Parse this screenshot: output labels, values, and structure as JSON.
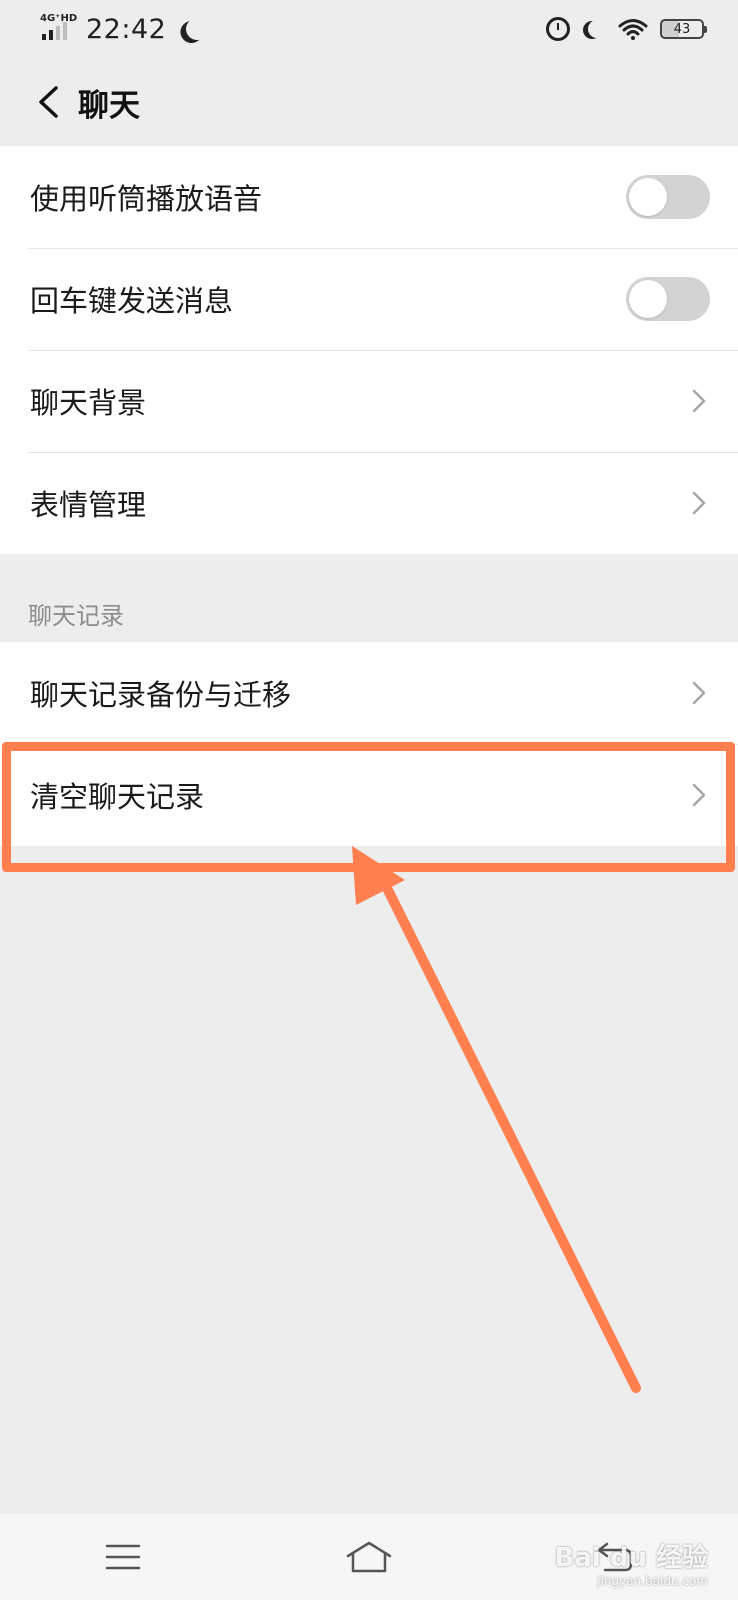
{
  "status_bar": {
    "network_type": "4G⁺HD",
    "time": "22:42",
    "battery": "43",
    "icons": [
      "moon-icon",
      "alarm-icon",
      "do-not-disturb-icon",
      "wifi-icon",
      "battery-icon"
    ]
  },
  "header": {
    "back_icon": "chevron-left-icon",
    "title": "聊天"
  },
  "settings_group_1": [
    {
      "label": "使用听筒播放语音",
      "control": "toggle",
      "state": "off"
    },
    {
      "label": "回车键发送消息",
      "control": "toggle",
      "state": "off"
    },
    {
      "label": "聊天背景",
      "control": "chevron"
    },
    {
      "label": "表情管理",
      "control": "chevron"
    }
  ],
  "section_chat_history": {
    "title": "聊天记录",
    "items": [
      {
        "label": "聊天记录备份与迁移",
        "control": "chevron"
      },
      {
        "label": "清空聊天记录",
        "control": "chevron",
        "highlighted": true
      }
    ]
  },
  "colors": {
    "background": "#ededed",
    "card": "#ffffff",
    "toggle_off": "#d3d3d3",
    "annotation": "#ff7f4f",
    "section_title": "#8c8c8c"
  },
  "nav_bar": {
    "icons": [
      "menu-icon",
      "home-icon",
      "back-nav-icon"
    ]
  },
  "watermark": {
    "brand": "Bai du 经验",
    "url": "jingyan.baidu.com"
  }
}
